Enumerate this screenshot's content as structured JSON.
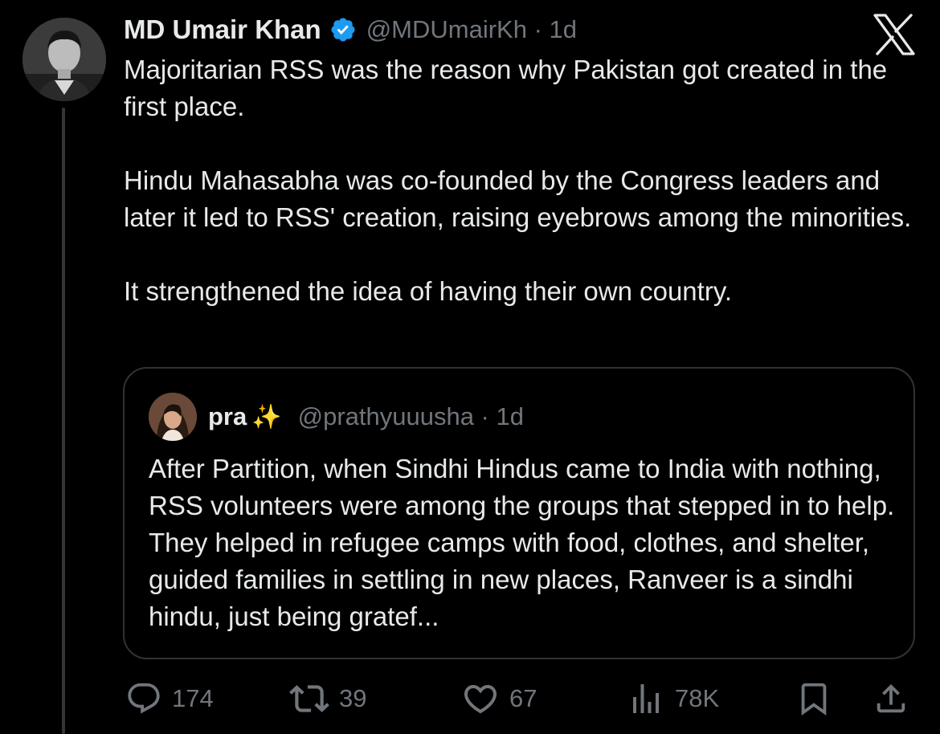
{
  "tweet": {
    "author_name": "MD Umair Khan",
    "handle_time": "@MDUmairKh · 1d",
    "paragraphs": [
      "Majoritarian RSS was the reason why Pakistan got created in the first place.",
      "Hindu Mahasabha was co-founded by the Congress leaders and later it led to RSS' creation, raising eyebrows among the minorities.",
      "It strengthened the idea of having their own country."
    ],
    "verified_icon": "verified-badge-icon",
    "brand_icon": "x-logo-icon"
  },
  "quote": {
    "author_name": "pra",
    "emoji": "✨",
    "handle_time": "@prathyuuusha · 1d",
    "text": "After Partition, when Sindhi Hindus came to India with nothing, RSS volunteers were among the groups that stepped in to help. They helped in refugee camps with food, clothes, and shelter, guided families in settling in new places, Ranveer is a sindhi hindu, just being gratef..."
  },
  "actions": {
    "replies": "174",
    "reposts": "39",
    "likes": "67",
    "views": "78K"
  },
  "colors": {
    "background": "#000000",
    "text": "#e7e9ea",
    "muted": "#71767b",
    "verified": "#1d9bf0",
    "border": "#2f3336"
  }
}
